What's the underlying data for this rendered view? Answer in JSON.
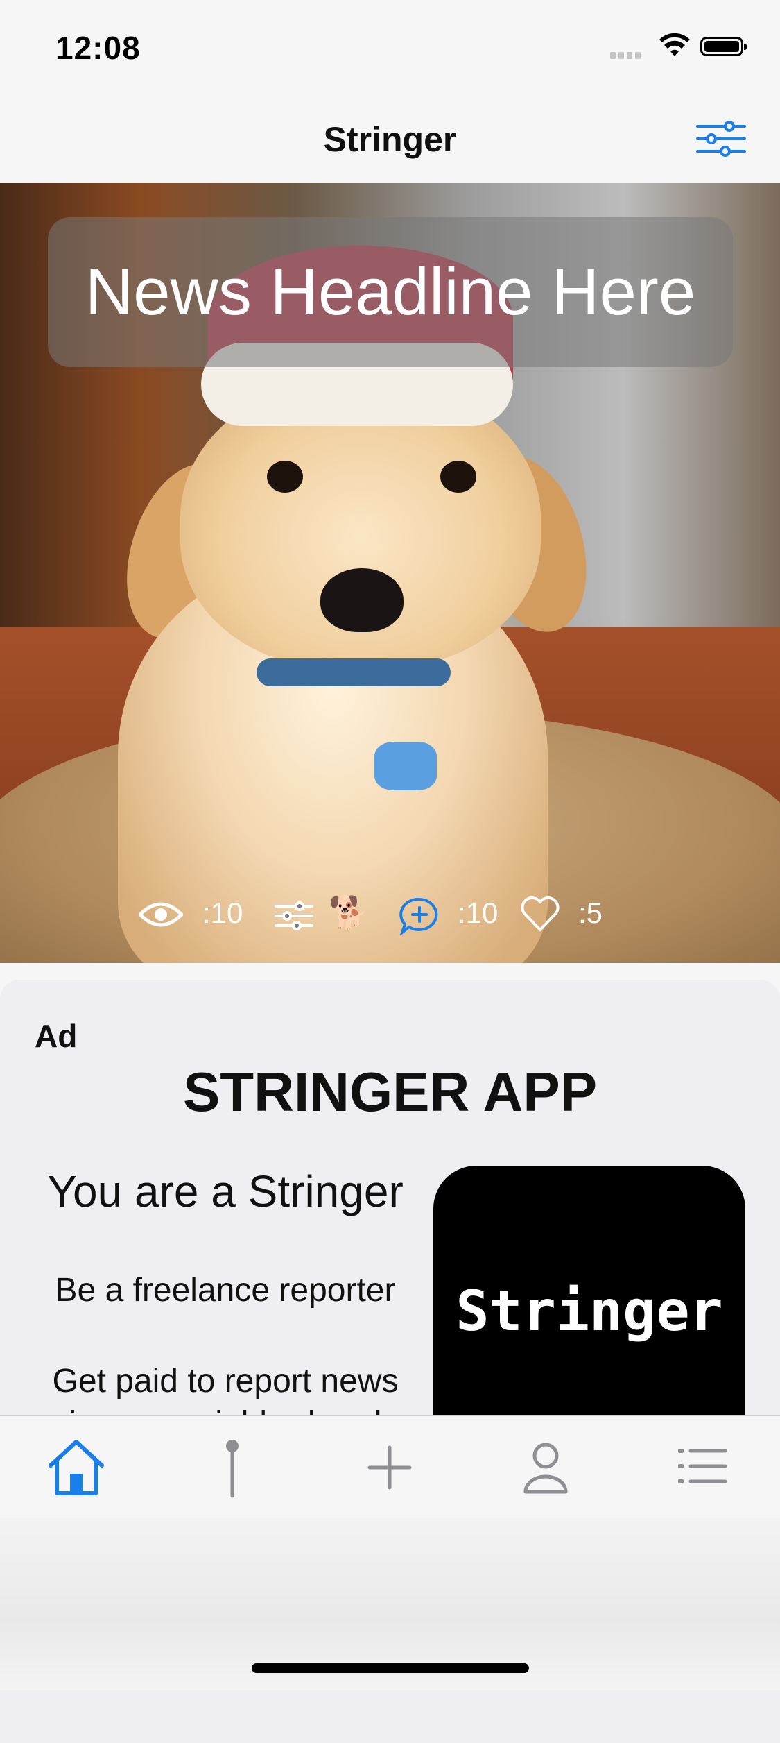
{
  "status_bar": {
    "time": "12:08"
  },
  "nav": {
    "title": "Stringer",
    "filter_icon": "sliders-icon"
  },
  "headline": {
    "text": "News Headline Here"
  },
  "stats": {
    "views": ":10",
    "dog_emoji": "🐕",
    "comments": ":10",
    "likes": ":5"
  },
  "ad": {
    "label": "Ad",
    "title": "STRINGER APP",
    "line1": "You are a Stringer",
    "line2": "Be a freelance reporter",
    "line3": "Get paid to report news",
    "line4": "in your neighborhood",
    "logo_text": "Stringer"
  },
  "tab_bar": {
    "items": [
      {
        "icon": "home-icon",
        "active": true
      },
      {
        "icon": "map-pin-icon",
        "active": false
      },
      {
        "icon": "plus-icon",
        "active": false
      },
      {
        "icon": "profile-icon",
        "active": false
      },
      {
        "icon": "list-icon",
        "active": false
      }
    ]
  },
  "colors": {
    "accent": "#1a7fe8",
    "inactive": "#8e8e93"
  }
}
